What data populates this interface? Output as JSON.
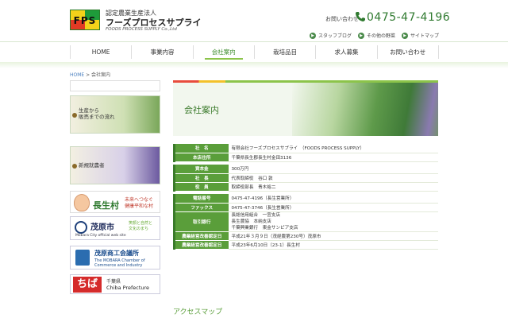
{
  "header": {
    "logo_text": "FPS",
    "brand_small": "認定農業生産法人",
    "brand_name": "フーズプロセスサプライ",
    "brand_en": "FOODS PROCESS SUPPLY Co.,Ltd",
    "contact_label": "お問い合わせ",
    "phone": "0475-47-4196",
    "subnav": [
      "スタッフブログ",
      "その他の野菜",
      "サイトマップ"
    ]
  },
  "nav": {
    "tabs": [
      "HOME",
      "事業内容",
      "会社案内",
      "栽培品目",
      "求人募集",
      "お問い合わせ"
    ],
    "active_index": 2
  },
  "breadcrumb": {
    "home": "HOME",
    "sep": " > ",
    "current": "会社案内"
  },
  "sidebar": {
    "banner1": [
      "生産から",
      "販売までの流れ"
    ],
    "banner2": "新規就農者",
    "banner3": {
      "name": "長生村",
      "tagline1": "未来へつなぐ",
      "tagline2": "健康平和な村"
    },
    "banner4": {
      "name": "茂原市",
      "sub": "Mobara City official web site",
      "tag1": "笑顔と自然と",
      "tag2": "文化のまち"
    },
    "banner5": {
      "name": "茂原商工会議所",
      "sub1": "The MOBARA Chamber of",
      "sub2": "Commerce and Industry"
    },
    "banner6": {
      "logo": "ちば",
      "t1": "千葉県",
      "t2": "Chiba Prefecture"
    }
  },
  "hero": {
    "title": "会社案内"
  },
  "company": [
    {
      "k": "社　名",
      "v": "有限会社フーズプロセスサプライ　（FOODS PROCESS SUPPLY）"
    },
    {
      "k": "本店住所",
      "v": "千葉県長生郡長生村金田3136"
    },
    {
      "gap": true
    },
    {
      "k": "資本金",
      "v": "300万円"
    },
    {
      "k": "社　長",
      "v": "代表取締役　谷口 敦"
    },
    {
      "k": "役　員",
      "v": "取締役部長　青木裕二"
    },
    {
      "gap": true
    },
    {
      "k": "電話番号",
      "v": "0475-47-4196（長生営業所）"
    },
    {
      "k": "ファックス",
      "v": "0475-47-3746（長生営業所）"
    },
    {
      "k": "取引銀行",
      "v": "長総信用組合　一宮支店\n長生農協　本納支店\n千葉興業銀行　東金サンピア支店"
    },
    {
      "k": "農業経営改善認定日",
      "v": "平成21年３月９日（茂経農第230号）茂原市"
    },
    {
      "k": "農業経営改善認定日",
      "v": "平成23年6月10日（23-1）長生村"
    }
  ],
  "access_title": "アクセスマップ"
}
